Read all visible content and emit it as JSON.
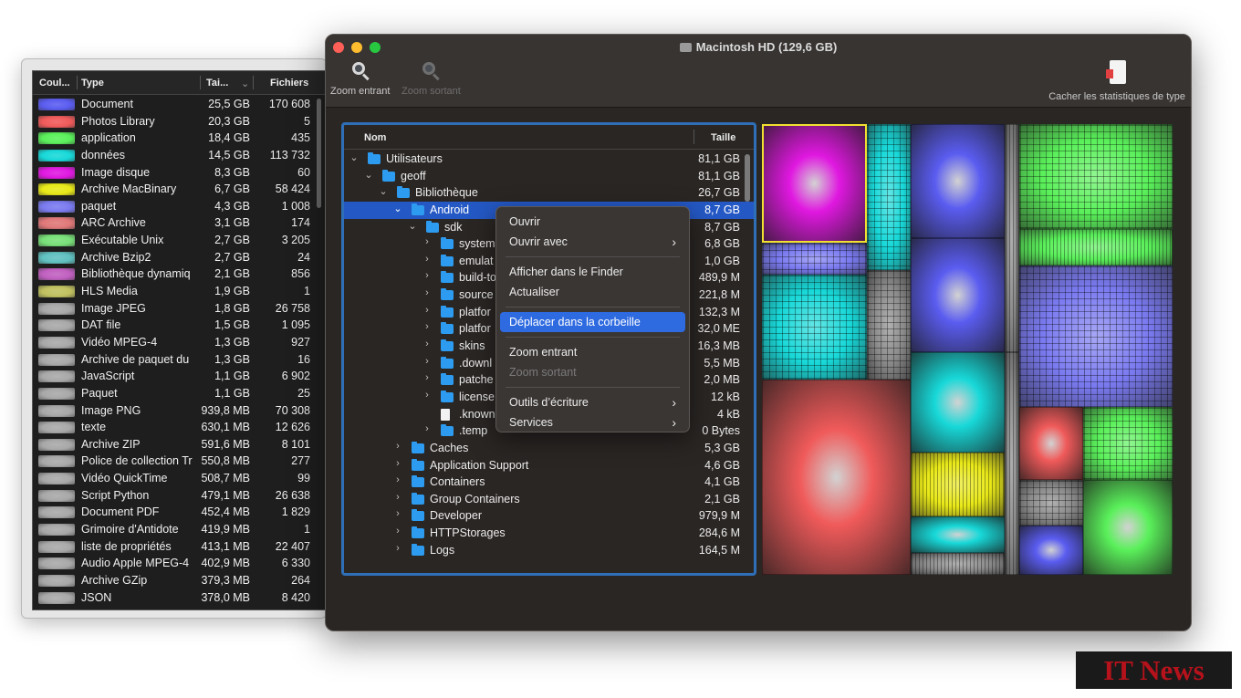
{
  "types_panel": {
    "columns": {
      "color": "Coul...",
      "type": "Type",
      "size": "Tai...",
      "files": "Fichiers"
    },
    "rows": [
      {
        "color": "#5a5cf0",
        "type": "Document",
        "size": "25,5 GB",
        "files": "170 608"
      },
      {
        "color": "#f05a5a",
        "type": "Photos Library",
        "size": "20,3 GB",
        "files": "5"
      },
      {
        "color": "#5af05a",
        "type": "application",
        "size": "18,4 GB",
        "files": "435"
      },
      {
        "color": "#18d8d8",
        "type": "données",
        "size": "14,5 GB",
        "files": "113 732"
      },
      {
        "color": "#e018e0",
        "type": "Image disque",
        "size": "8,3 GB",
        "files": "60"
      },
      {
        "color": "#e8e818",
        "type": "Archive MacBinary",
        "size": "6,7 GB",
        "files": "58 424"
      },
      {
        "color": "#7a7af0",
        "type": "paquet",
        "size": "4,3 GB",
        "files": "1 008"
      },
      {
        "color": "#e07878",
        "type": "ARC Archive",
        "size": "3,1 GB",
        "files": "174"
      },
      {
        "color": "#78e078",
        "type": "Exécutable Unix",
        "size": "2,7 GB",
        "files": "3 205"
      },
      {
        "color": "#60c0c0",
        "type": "Archive Bzip2",
        "size": "2,7 GB",
        "files": "24"
      },
      {
        "color": "#c060c0",
        "type": "Bibliothèque dynamiq",
        "size": "2,1 GB",
        "files": "856"
      },
      {
        "color": "#c0c060",
        "type": "HLS Media",
        "size": "1,9 GB",
        "files": "1"
      },
      {
        "color": "#a8a8a8",
        "type": "Image JPEG",
        "size": "1,8 GB",
        "files": "26 758"
      },
      {
        "color": "#a8a8a8",
        "type": "DAT file",
        "size": "1,5 GB",
        "files": "1 095"
      },
      {
        "color": "#a8a8a8",
        "type": "Vidéo MPEG-4",
        "size": "1,3 GB",
        "files": "927"
      },
      {
        "color": "#a8a8a8",
        "type": "Archive de paquet du",
        "size": "1,3 GB",
        "files": "16"
      },
      {
        "color": "#a8a8a8",
        "type": "JavaScript",
        "size": "1,1 GB",
        "files": "6 902"
      },
      {
        "color": "#a8a8a8",
        "type": "Paquet",
        "size": "1,1 GB",
        "files": "25"
      },
      {
        "color": "#a8a8a8",
        "type": "Image PNG",
        "size": "939,8 MB",
        "files": "70 308"
      },
      {
        "color": "#a8a8a8",
        "type": "texte",
        "size": "630,1 MB",
        "files": "12 626"
      },
      {
        "color": "#a8a8a8",
        "type": "Archive ZIP",
        "size": "591,6 MB",
        "files": "8 101"
      },
      {
        "color": "#a8a8a8",
        "type": "Police de collection Tr",
        "size": "550,8 MB",
        "files": "277"
      },
      {
        "color": "#a8a8a8",
        "type": "Vidéo QuickTime",
        "size": "508,7 MB",
        "files": "99"
      },
      {
        "color": "#a8a8a8",
        "type": "Script Python",
        "size": "479,1 MB",
        "files": "26 638"
      },
      {
        "color": "#a8a8a8",
        "type": "Document PDF",
        "size": "452,4 MB",
        "files": "1 829"
      },
      {
        "color": "#a8a8a8",
        "type": "Grimoire d'Antidote",
        "size": "419,9 MB",
        "files": "1"
      },
      {
        "color": "#a8a8a8",
        "type": "liste de propriétés",
        "size": "413,1 MB",
        "files": "22 407"
      },
      {
        "color": "#a8a8a8",
        "type": "Audio Apple MPEG-4",
        "size": "402,9 MB",
        "files": "6 330"
      },
      {
        "color": "#a8a8a8",
        "type": "Archive GZip",
        "size": "379,3 MB",
        "files": "264"
      },
      {
        "color": "#a8a8a8",
        "type": "JSON",
        "size": "378,0 MB",
        "files": "8 420"
      }
    ]
  },
  "window": {
    "title": "Macintosh HD (129,6 GB)",
    "toolbar": {
      "zoom_in": "Zoom entrant",
      "zoom_out": "Zoom sortant",
      "hide_stats": "Cacher les statistiques de type"
    }
  },
  "tree": {
    "columns": {
      "name": "Nom",
      "size": "Taille"
    },
    "rows": [
      {
        "level": 0,
        "name": "Utilisateurs",
        "size": "81,1 GB",
        "expanded": true,
        "icon": "folder-icon"
      },
      {
        "level": 1,
        "name": "geoff",
        "size": "81,1 GB",
        "expanded": true,
        "icon": "folder-icon"
      },
      {
        "level": 2,
        "name": "Bibliothèque",
        "size": "26,7 GB",
        "expanded": true,
        "icon": "folder-icon"
      },
      {
        "level": 3,
        "name": "Android",
        "size": "8,7 GB",
        "expanded": true,
        "icon": "folder-icon",
        "selected": true
      },
      {
        "level": 4,
        "name": "sdk",
        "size": "8,7 GB",
        "expanded": true,
        "icon": "folder-icon"
      },
      {
        "level": 5,
        "name": "system",
        "size": "6,8 GB",
        "expanded": false,
        "icon": "folder-icon"
      },
      {
        "level": 5,
        "name": "emulat",
        "size": "1,0 GB",
        "expanded": false,
        "icon": "folder-icon"
      },
      {
        "level": 5,
        "name": "build-to",
        "size": "489,9 M",
        "expanded": false,
        "icon": "folder-icon"
      },
      {
        "level": 5,
        "name": "source",
        "size": "221,8 M",
        "expanded": false,
        "icon": "folder-icon"
      },
      {
        "level": 5,
        "name": "platfor",
        "size": "132,3 M",
        "expanded": false,
        "icon": "folder-icon"
      },
      {
        "level": 5,
        "name": "platfor",
        "size": "32,0 ME",
        "expanded": false,
        "icon": "folder-icon"
      },
      {
        "level": 5,
        "name": "skins",
        "size": "16,3 MB",
        "expanded": false,
        "icon": "folder-icon"
      },
      {
        "level": 5,
        "name": ".downl",
        "size": "5,5 MB",
        "expanded": false,
        "icon": "folder-icon"
      },
      {
        "level": 5,
        "name": "patche",
        "size": "2,0 MB",
        "expanded": false,
        "icon": "folder-icon"
      },
      {
        "level": 5,
        "name": "license",
        "size": "12 kB",
        "expanded": false,
        "icon": "folder-icon"
      },
      {
        "level": 5,
        "name": ".known",
        "size": "4 kB",
        "expanded": null,
        "icon": "file-icon"
      },
      {
        "level": 5,
        "name": ".temp",
        "size": "0 Bytes",
        "expanded": false,
        "icon": "folder-icon"
      },
      {
        "level": 3,
        "name": "Caches",
        "size": "5,3 GB",
        "expanded": false,
        "icon": "folder-icon"
      },
      {
        "level": 3,
        "name": "Application Support",
        "size": "4,6 GB",
        "expanded": false,
        "icon": "folder-icon"
      },
      {
        "level": 3,
        "name": "Containers",
        "size": "4,1 GB",
        "expanded": false,
        "icon": "folder-icon"
      },
      {
        "level": 3,
        "name": "Group Containers",
        "size": "2,1 GB",
        "expanded": false,
        "icon": "folder-icon"
      },
      {
        "level": 3,
        "name": "Developer",
        "size": "979,9 M",
        "expanded": false,
        "icon": "folder-icon"
      },
      {
        "level": 3,
        "name": "HTTPStorages",
        "size": "284,6 M",
        "expanded": false,
        "icon": "folder-icon"
      },
      {
        "level": 3,
        "name": "Logs",
        "size": "164,5 M",
        "expanded": false,
        "icon": "folder-icon"
      }
    ]
  },
  "context_menu": {
    "groups": [
      [
        {
          "label": "Ouvrir",
          "submenu": false,
          "disabled": false,
          "highlighted": false
        },
        {
          "label": "Ouvrir avec",
          "submenu": true,
          "disabled": false,
          "highlighted": false
        }
      ],
      [
        {
          "label": "Afficher dans le Finder",
          "submenu": false,
          "disabled": false,
          "highlighted": false
        },
        {
          "label": "Actualiser",
          "submenu": false,
          "disabled": false,
          "highlighted": false
        }
      ],
      [
        {
          "label": "Déplacer dans la corbeille",
          "submenu": false,
          "disabled": false,
          "highlighted": true
        }
      ],
      [
        {
          "label": "Zoom entrant",
          "submenu": false,
          "disabled": false,
          "highlighted": false
        },
        {
          "label": "Zoom sortant",
          "submenu": false,
          "disabled": true,
          "highlighted": false
        }
      ],
      [
        {
          "label": "Outils d’écriture",
          "submenu": true,
          "disabled": false,
          "highlighted": false
        },
        {
          "label": "Services",
          "submenu": true,
          "disabled": false,
          "highlighted": false
        }
      ]
    ]
  },
  "watermark": {
    "text": "IT News"
  }
}
